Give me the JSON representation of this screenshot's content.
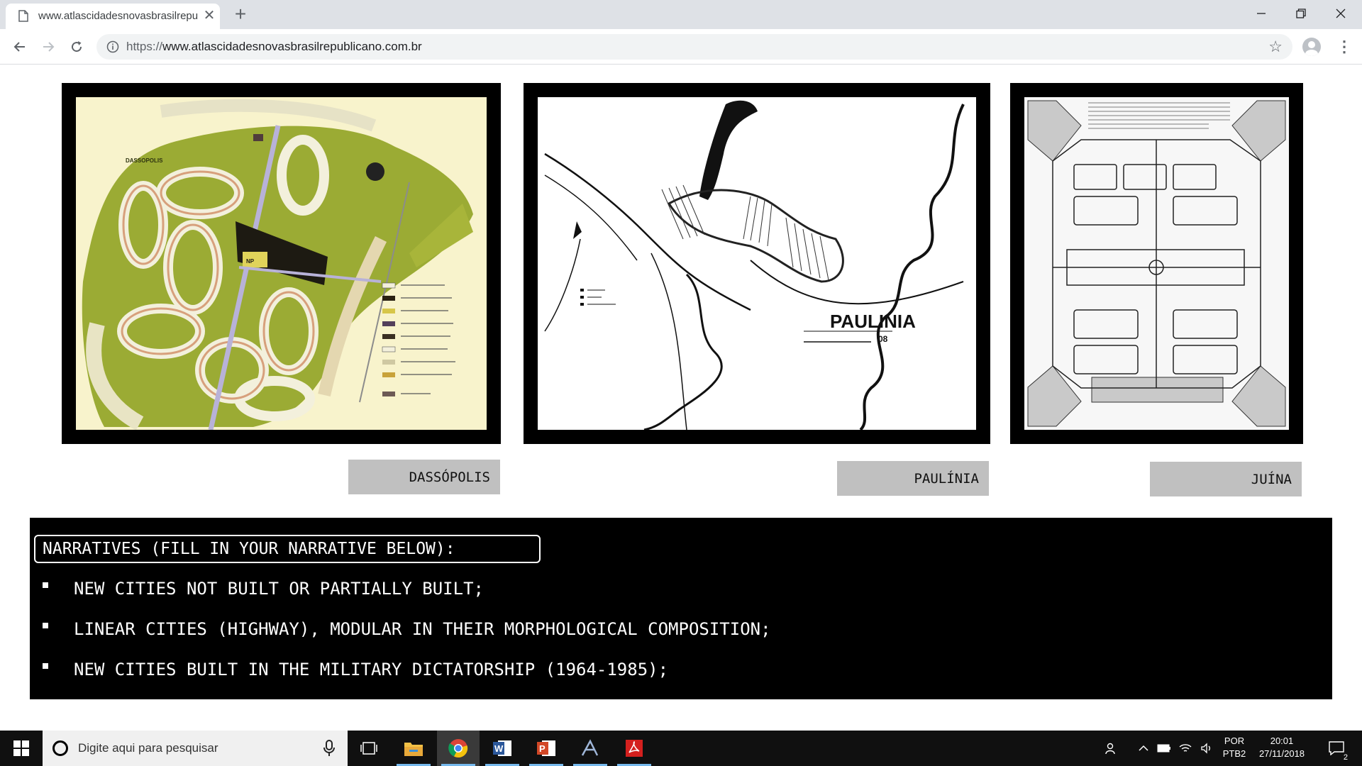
{
  "browser": {
    "tab_title": "www.atlascidadesnovasbrasilrepublicano.com.br",
    "url_prefix": "https://",
    "url_domain": "www.atlascidadesnovasbrasilrepublicano.com.br"
  },
  "maps": [
    {
      "caption": "DASSÓPOLIS",
      "map_texts": [
        "DASSOPOLIS",
        "NP"
      ]
    },
    {
      "caption": "PAULÍNIA",
      "map_texts": [
        "PAULINIA",
        "08"
      ]
    },
    {
      "caption": "JUÍNA",
      "map_texts": []
    }
  ],
  "narratives": {
    "heading": "NARRATIVES (FILL IN YOUR NARRATIVE BELOW):",
    "items": [
      "NEW CITIES NOT BUILT OR PARTIALLY BUILT;",
      "LINEAR CITIES (HIGHWAY), MODULAR IN THEIR MORPHOLOGICAL COMPOSITION;",
      "NEW CITIES BUILT IN THE MILITARY DICTATORSHIP (1964-1985);"
    ]
  },
  "taskbar": {
    "search_placeholder": "Digite aqui para pesquisar",
    "language": "POR",
    "layout": "PTB2",
    "time": "20:01",
    "date": "27/11/2018",
    "notification_count": "2"
  }
}
